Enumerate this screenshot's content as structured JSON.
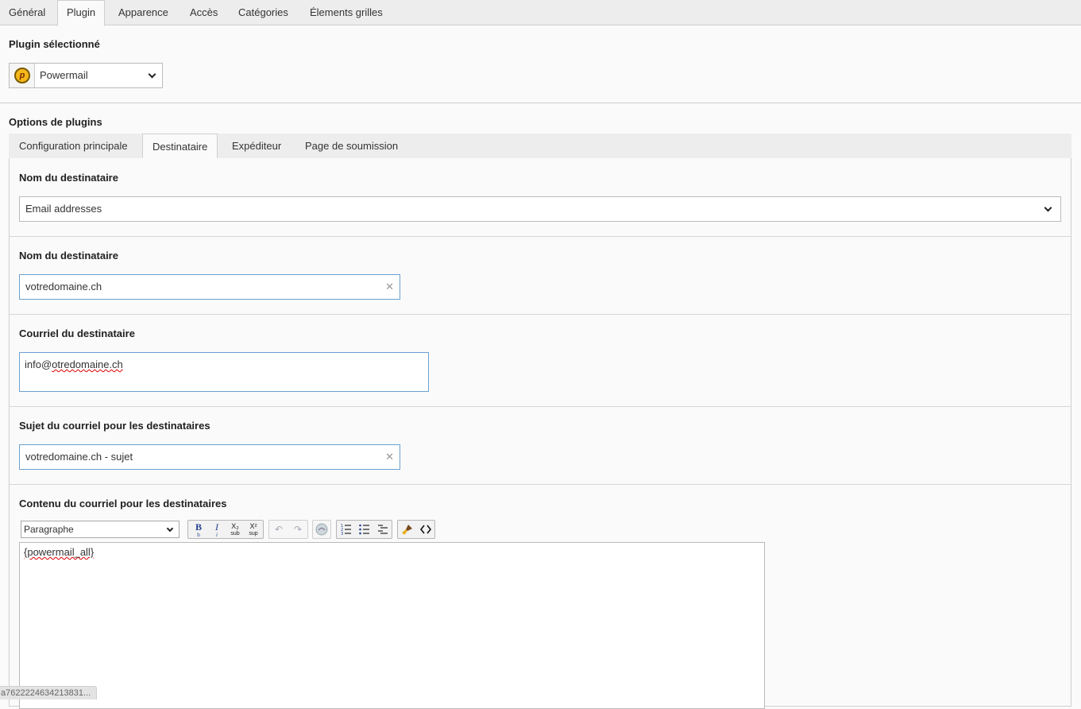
{
  "top_tabs": [
    "Général",
    "Plugin",
    "Apparence",
    "Accès",
    "Catégories",
    "Élements grilles"
  ],
  "plugin_section": {
    "heading": "Plugin sélectionné",
    "selected_plugin": "Powermail",
    "plugin_icon_letter": "p"
  },
  "options_section": {
    "heading": "Options de plugins",
    "tabs": [
      "Configuration principale",
      "Destinataire",
      "Expéditeur",
      "Page de soumission"
    ],
    "active_tab": "Destinataire"
  },
  "fields": {
    "recipient_type": {
      "label": "Nom du destinataire",
      "value": "Email addresses"
    },
    "recipient_name": {
      "label": "Nom du destinataire",
      "value": "votredomaine.ch"
    },
    "recipient_email": {
      "label": "Courriel du destinataire",
      "value_prefix": "info@",
      "value_misspelled": "otredomaine.ch"
    },
    "subject": {
      "label": "Sujet du courriel pour les destinataires",
      "value": "votredomaine.ch - sujet"
    },
    "body": {
      "label": "Contenu du courriel pour les destinataires",
      "content": "{powermail_all}"
    }
  },
  "rte": {
    "format_select": "Paragraphe",
    "buttons": {
      "bold": "B",
      "italic": "I",
      "subscript": "X₂",
      "superscript": "X²",
      "undo": "↶",
      "redo": "↷"
    },
    "button_captions": {
      "bold": "b",
      "italic": "i",
      "subscript": "sub",
      "superscript": "sup"
    }
  },
  "status_bar_text": "a7622224634213831...",
  "colors": {
    "focus_border": "#6ba0d0",
    "tab_bg": "#ededed",
    "page_bg": "#fafafa"
  }
}
